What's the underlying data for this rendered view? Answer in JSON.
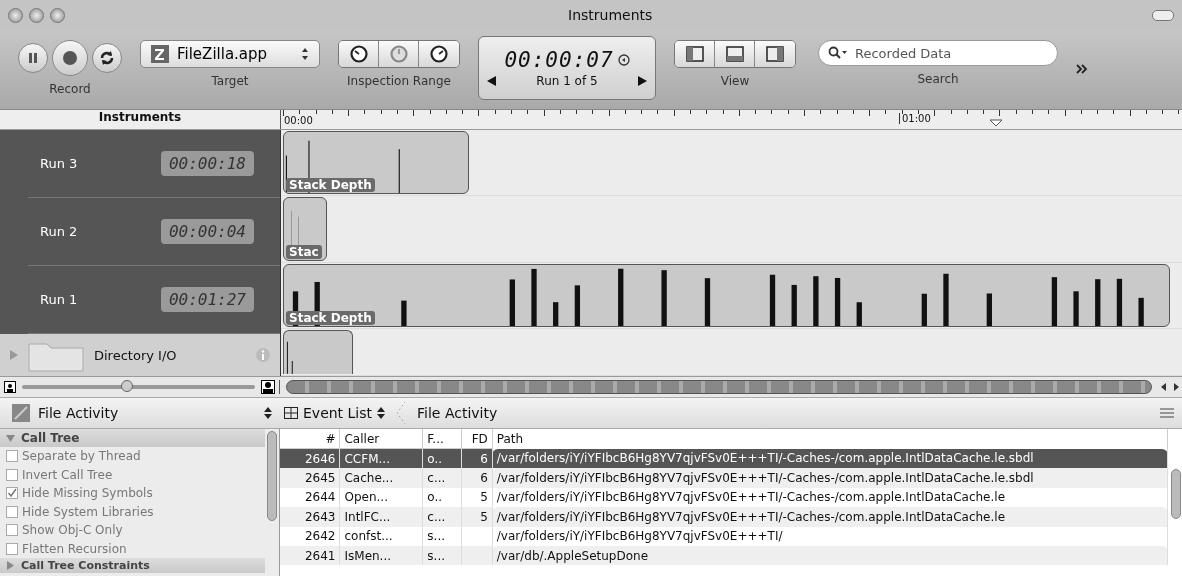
{
  "window": {
    "title": "Instruments"
  },
  "toolbar": {
    "record_label": "Record",
    "target": {
      "value": "FileZilla.app",
      "label": "Target"
    },
    "inspection_label": "Inspection Range",
    "timer": {
      "time": "00:00:07",
      "run": "Run 1 of 5"
    },
    "view_label": "View",
    "search": {
      "placeholder": "Recorded Data",
      "label": "Search"
    }
  },
  "timeline": {
    "header": "Instruments",
    "ticks": [
      "00:00",
      "01:00"
    ],
    "runs": [
      {
        "name": "Run 3",
        "time": "00:00:18",
        "track_label": "Stack Depth"
      },
      {
        "name": "Run 2",
        "time": "00:00:04",
        "track_label": "Stac"
      },
      {
        "name": "Run 1",
        "time": "00:01:27",
        "track_label": "Stack Depth"
      }
    ],
    "instrument": {
      "name": "Directory I/O"
    },
    "zoom_slider": {
      "level": 0.45
    }
  },
  "detail": {
    "instrument": "File Activity",
    "view": "Event List",
    "crumb": "File Activity",
    "options": {
      "title": "Call Tree",
      "expanded": true,
      "items": [
        {
          "label": "Separate by Thread",
          "checked": false
        },
        {
          "label": "Invert Call Tree",
          "checked": false
        },
        {
          "label": "Hide Missing Symbols",
          "checked": true
        },
        {
          "label": "Hide System Libraries",
          "checked": false
        },
        {
          "label": "Show Obj-C Only",
          "checked": false
        },
        {
          "label": "Flatten Recursion",
          "checked": false
        }
      ]
    },
    "constraints": {
      "title": "Call Tree Constraints",
      "expanded": false
    },
    "table": {
      "columns": [
        "#",
        "Caller",
        "F...",
        "FD",
        "Path"
      ],
      "rows": [
        {
          "cells": [
            "2646",
            "CCFM...",
            "o..",
            "6",
            "/var/folders/iY/iYFIbcB6Hg8YV7qjvFSv0E+++TI/-Caches-/com.apple.IntlDataCache.le.sbdl"
          ],
          "selected": true
        },
        {
          "cells": [
            "2645",
            "Cache...",
            "c...",
            "6",
            "/var/folders/iY/iYFIbcB6Hg8YV7qjvFSv0E+++TI/-Caches-/com.apple.IntlDataCache.le.sbdl"
          ],
          "selected": false
        },
        {
          "cells": [
            "2644",
            "Open...",
            "o..",
            "5",
            "/var/folders/iY/iYFIbcB6Hg8YV7qjvFSv0E+++TI/-Caches-/com.apple.IntlDataCache.le"
          ],
          "selected": false
        },
        {
          "cells": [
            "2643",
            "IntlFC...",
            "c...",
            "5",
            "/var/folders/iY/iYFIbcB6Hg8YV7qjvFSv0E+++TI/-Caches-/com.apple.IntlDataCache.le"
          ],
          "selected": false
        },
        {
          "cells": [
            "2642",
            "confst...",
            "s...",
            "",
            "/var/folders/iY/iYFIbcB6Hg8YV7qjvFSv0E+++TI/"
          ],
          "selected": false
        },
        {
          "cells": [
            "2641",
            "IsMen...",
            "s...",
            "",
            "/var/db/.AppleSetupDone"
          ],
          "selected": false
        }
      ]
    }
  }
}
